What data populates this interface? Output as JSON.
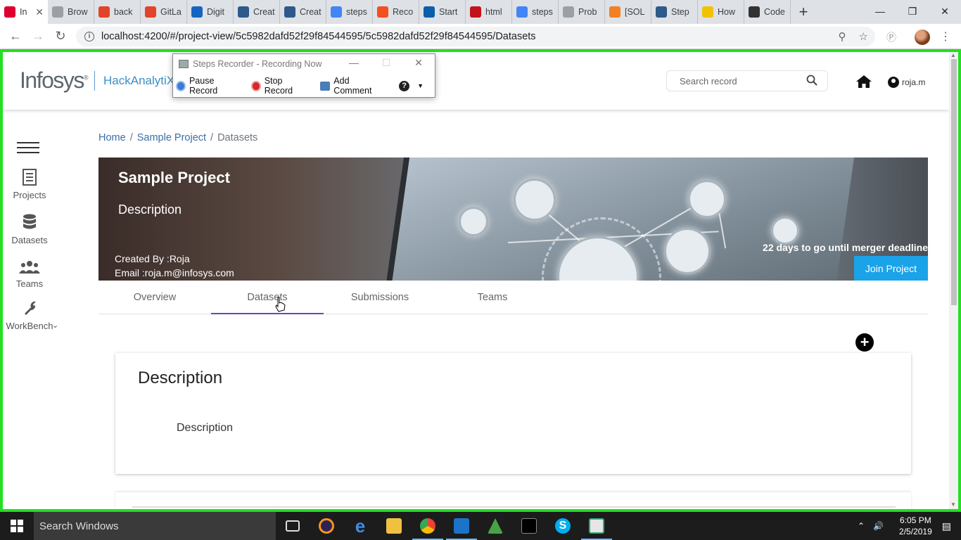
{
  "browser": {
    "tabs": [
      {
        "label": "In",
        "color": "#dd0031",
        "active": true,
        "icon": "angular-icon"
      },
      {
        "label": "Brow",
        "color": "#9aa0a6",
        "icon": "page-icon"
      },
      {
        "label": "back",
        "color": "#e24329",
        "icon": "gitlab-icon"
      },
      {
        "label": "GitLa",
        "color": "#e24329",
        "icon": "gitlab-icon"
      },
      {
        "label": "Digit",
        "color": "#1565c0",
        "icon": "k-icon"
      },
      {
        "label": "Creat",
        "color": "#2d5a8a",
        "icon": "doc-icon"
      },
      {
        "label": "Creat",
        "color": "#2d5a8a",
        "icon": "doc-icon"
      },
      {
        "label": "steps",
        "color": "#4285f4",
        "icon": "google-icon"
      },
      {
        "label": "Reco",
        "color": "#f25022",
        "icon": "microsoft-icon"
      },
      {
        "label": "Start",
        "color": "#0a5fa8",
        "icon": "flag-icon"
      },
      {
        "label": "html",
        "color": "#c4121a",
        "icon": "n-icon"
      },
      {
        "label": "steps",
        "color": "#4285f4",
        "icon": "google-icon"
      },
      {
        "label": "Prob",
        "color": "#9aa0a6",
        "icon": "page-icon"
      },
      {
        "label": "[SOL",
        "color": "#f48024",
        "icon": "so-icon"
      },
      {
        "label": "Step",
        "color": "#2d5a8a",
        "icon": "doc-icon"
      },
      {
        "label": "How",
        "color": "#f2c200",
        "icon": "l-icon"
      },
      {
        "label": "Code",
        "color": "#333333",
        "icon": "codepen-icon"
      }
    ],
    "url": "localhost:4200/#/project-view/5c5982dafd52f29f84544595/5c5982dafd52f29f84544595/Datasets"
  },
  "recorder": {
    "title": "Steps Recorder - Recording Now",
    "pause": "Pause Record",
    "stop": "Stop Record",
    "comment": "Add Comment"
  },
  "header": {
    "brand": "Infosys",
    "product": "HackAnalytiX",
    "search_placeholder": "Search record",
    "user": "roja.m"
  },
  "sidebar": {
    "items": [
      {
        "label": "Projects",
        "icon": "projects-icon"
      },
      {
        "label": "Datasets",
        "icon": "database-icon"
      },
      {
        "label": "Teams",
        "icon": "teams-icon"
      },
      {
        "label": "WorkBench",
        "icon": "wrench-icon"
      }
    ]
  },
  "breadcrumb": {
    "home": "Home",
    "project": "Sample Project",
    "current": "Datasets",
    "sep": "/"
  },
  "banner": {
    "title": "Sample Project",
    "description": "Description",
    "created_by": "Created By :Roja",
    "email": "Email :roja.m@infosys.com",
    "deadline": "22 days to go until merger deadline",
    "join": "Join Project"
  },
  "tabs": [
    "Overview",
    "Datasets",
    "Submissions",
    "Teams"
  ],
  "active_tab": "Datasets",
  "card": {
    "heading": "Description",
    "body": "Description"
  },
  "taskbar": {
    "search": "Search Windows",
    "time": "6:05 PM",
    "date": "2/5/2019"
  },
  "colors": {
    "recording_border": "#22e022",
    "join_button": "#1aa3e8",
    "active_tab_underline": "#6f42c1",
    "link": "#3a6fa8"
  }
}
